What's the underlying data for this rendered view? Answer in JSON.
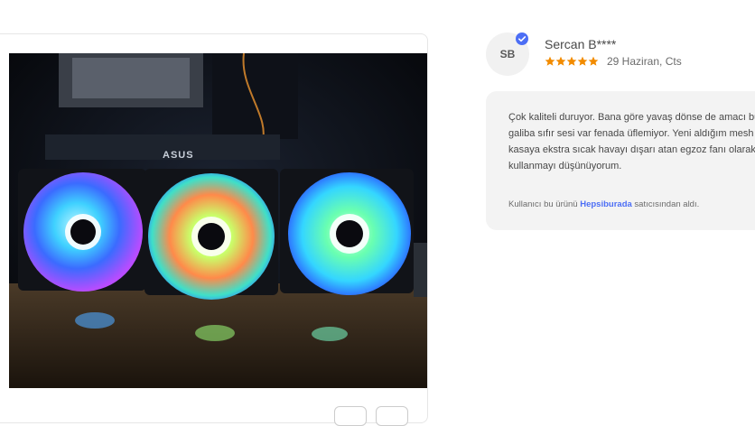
{
  "review": {
    "avatar_initials": "SB",
    "reviewer_name": "Sercan B****",
    "rating": 5,
    "rating_color": "#f28b00",
    "date": "29 Haziran, Cts",
    "text": "Çok kaliteli duruyor. Bana göre yavaş dönse de amacı bu galiba sıfır sesi var fenada üflemiyor. Yeni aldığım mesh kasaya ekstra sıcak havayı dışarı atan egzoz fanı olarak kullanmayı düşünüyorum.",
    "seller_prefix": "Kullanıcı bu ürünü",
    "seller_name": "Hepsiburada",
    "seller_suffix": "satıcısından aldı."
  },
  "photo": {
    "brand_label": "ASUS",
    "icon": "review-photo-rgb-fans"
  },
  "icons": {
    "verified": "verified-badge-icon",
    "star": "star-icon"
  }
}
